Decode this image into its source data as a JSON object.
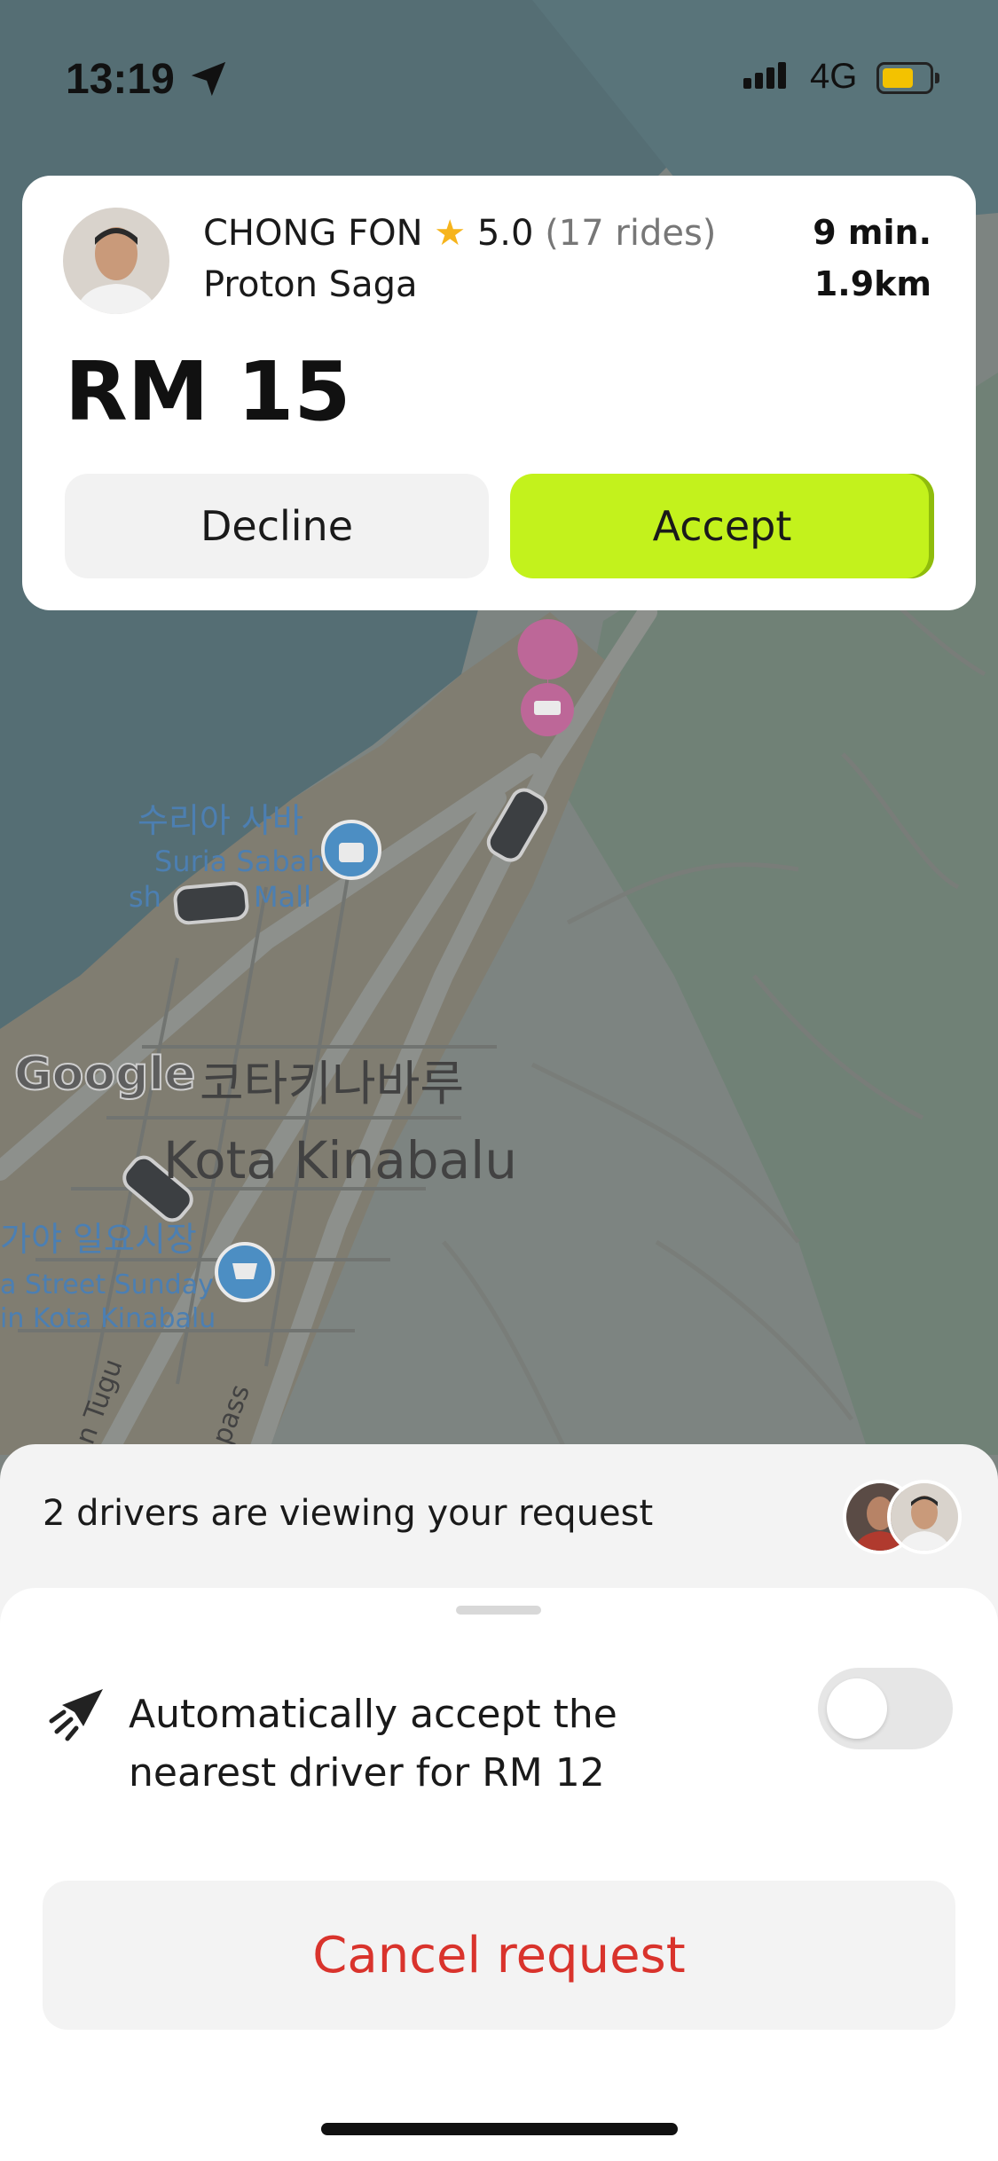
{
  "status_bar": {
    "time": "13:19",
    "network": "4G"
  },
  "offer": {
    "driver_name": "CHONG FON",
    "rating": "5.0",
    "rides": "(17 rides)",
    "car": "Proton Saga",
    "eta": "9 min.",
    "distance": "1.9km",
    "price": "RM 15",
    "decline_label": "Decline",
    "accept_label": "Accept"
  },
  "map": {
    "labels": {
      "suria_kr": "수리아 사바",
      "suria_en": "Suria Sabah",
      "mall_sh": "sh",
      "mall_en": "Mall",
      "kk_kr": "코타키나바루",
      "kk_en": "Kota Kinabalu",
      "market_kr": "가야 일요시장",
      "market_en1": "a Street Sunday",
      "market_en2": "in Kota Kinabalu",
      "road1": "n Tugu",
      "road2": "pass",
      "google": "Google"
    }
  },
  "sheet": {
    "viewing_text": "2 drivers are viewing your request",
    "auto_accept_text": "Automatically accept the nearest driver for RM 12",
    "auto_accept_enabled": false,
    "cancel_label": "Cancel request"
  },
  "colors": {
    "accept": "#c3f21c",
    "cancel_text": "#d9332c",
    "star": "#f6b41c"
  },
  "icons": [
    "location-arrow-icon",
    "signal-icon",
    "battery-icon",
    "star-icon",
    "hotel-pin-icon",
    "shopping-bag-pin-icon",
    "cart-pin-icon",
    "car-icon",
    "auto-accept-icon"
  ]
}
